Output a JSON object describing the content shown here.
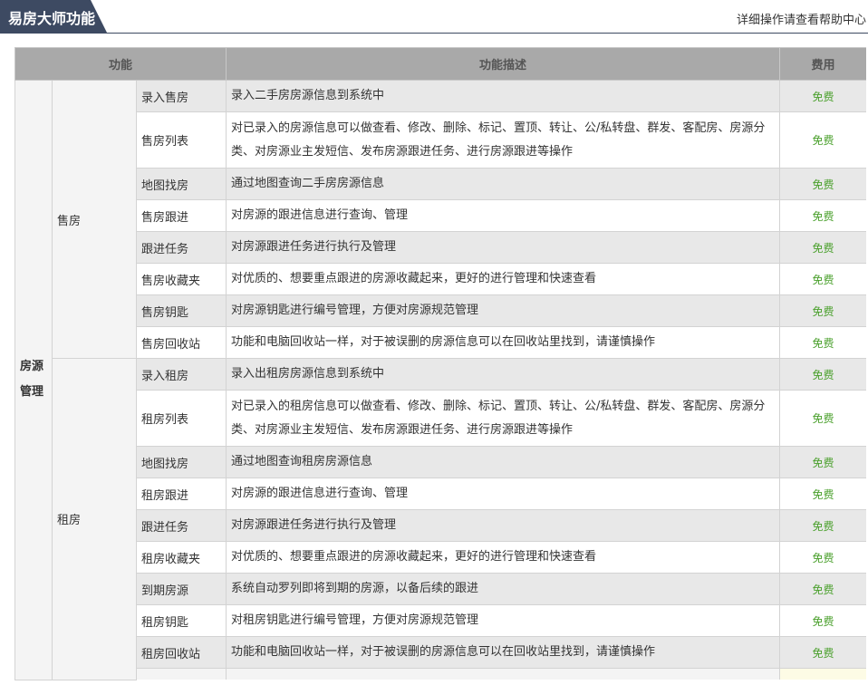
{
  "header": {
    "title": "易房大师功能",
    "help_text": "详细操作请查看帮助中心"
  },
  "table": {
    "columns": {
      "function": "功能",
      "description": "功能描述",
      "fee": "费用"
    },
    "category": "房源管理",
    "category_line1": "房源",
    "category_line2": "管理",
    "groups": [
      {
        "name": "售房",
        "rows": [
          {
            "name": "录入售房",
            "desc": "录入二手房房源信息到系统中",
            "fee": "免费"
          },
          {
            "name": "售房列表",
            "desc": "对已录入的房源信息可以做查看、修改、删除、标记、置顶、转让、公/私转盘、群发、客配房、房源分类、对房源业主发短信、发布房源跟进任务、进行房源跟进等操作",
            "fee": "免费"
          },
          {
            "name": "地图找房",
            "desc": "通过地图查询二手房房源信息",
            "fee": "免费"
          },
          {
            "name": "售房跟进",
            "desc": "对房源的跟进信息进行查询、管理",
            "fee": "免费"
          },
          {
            "name": "跟进任务",
            "desc": "对房源跟进任务进行执行及管理",
            "fee": "免费"
          },
          {
            "name": "售房收藏夹",
            "desc": "对优质的、想要重点跟进的房源收藏起来，更好的进行管理和快速查看",
            "fee": "免费"
          },
          {
            "name": "售房钥匙",
            "desc": "对房源钥匙进行编号管理，方便对房源规范管理",
            "fee": "免费"
          },
          {
            "name": "售房回收站",
            "desc": "功能和电脑回收站一样，对于被误删的房源信息可以在回收站里找到，请谨慎操作",
            "fee": "免费"
          }
        ]
      },
      {
        "name": "租房",
        "rows": [
          {
            "name": "录入租房",
            "desc": "录入出租房房源信息到系统中",
            "fee": "免费"
          },
          {
            "name": "租房列表",
            "desc": "对已录入的租房信息可以做查看、修改、删除、标记、置顶、转让、公/私转盘、群发、客配房、房源分类、对房源业主发短信、发布房源跟进任务、进行房源跟进等操作",
            "fee": "免费"
          },
          {
            "name": "地图找房",
            "desc": "通过地图查询租房房源信息",
            "fee": "免费"
          },
          {
            "name": "租房跟进",
            "desc": "对房源的跟进信息进行查询、管理",
            "fee": "免费"
          },
          {
            "name": "跟进任务",
            "desc": "对房源跟进任务进行执行及管理",
            "fee": "免费"
          },
          {
            "name": "租房收藏夹",
            "desc": "对优质的、想要重点跟进的房源收藏起来，更好的进行管理和快速查看",
            "fee": "免费"
          },
          {
            "name": "到期房源",
            "desc": "系统自动罗列即将到期的房源，以备后续的跟进",
            "fee": "免费"
          },
          {
            "name": "租房钥匙",
            "desc": "对租房钥匙进行编号管理，方便对房源规范管理",
            "fee": "免费"
          },
          {
            "name": "租房回收站",
            "desc": "功能和电脑回收站一样，对于被误删的房源信息可以在回收站里找到，请谨慎操作",
            "fee": "免费"
          }
        ]
      }
    ]
  }
}
